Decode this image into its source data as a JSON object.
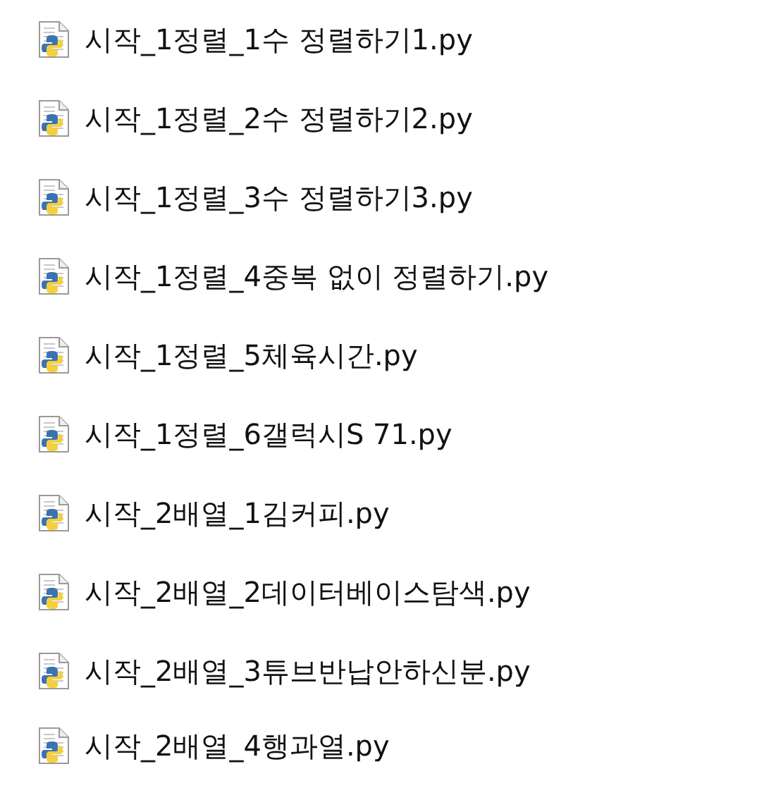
{
  "files": [
    {
      "name": "시작_1정렬_1수 정렬하기1.py"
    },
    {
      "name": "시작_1정렬_2수 정렬하기2.py"
    },
    {
      "name": "시작_1정렬_3수 정렬하기3.py"
    },
    {
      "name": "시작_1정렬_4중복 없이 정렬하기.py"
    },
    {
      "name": "시작_1정렬_5체육시간.py"
    },
    {
      "name": "시작_1정렬_6갤럭시S 71.py"
    },
    {
      "name": "시작_2배열_1김커피.py"
    },
    {
      "name": "시작_2배열_2데이터베이스탐색.py"
    },
    {
      "name": "시작_2배열_3튜브반납안하신분.py"
    },
    {
      "name": "시작_2배열_4행과열.py"
    }
  ]
}
